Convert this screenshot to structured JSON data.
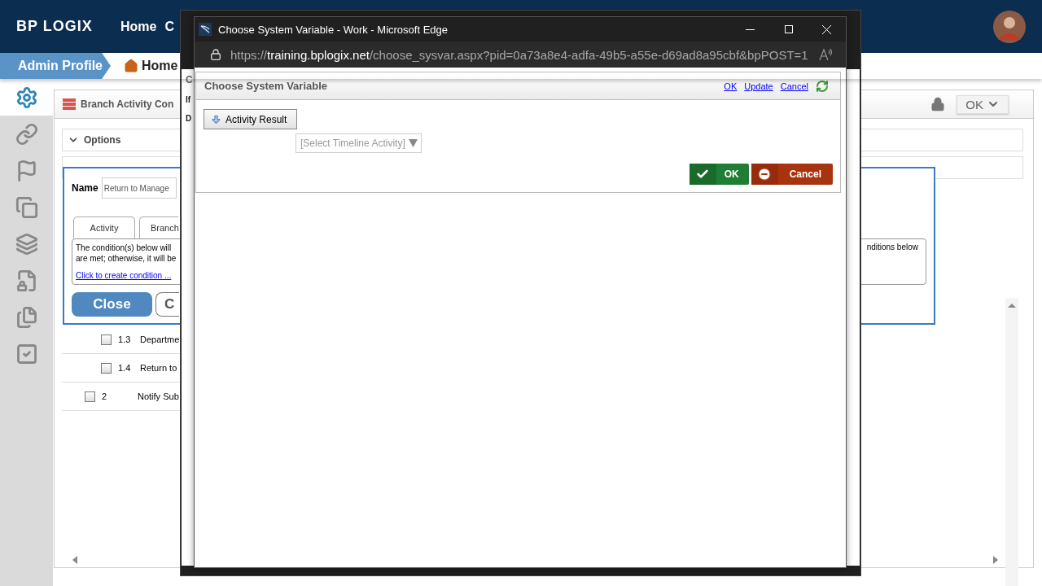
{
  "header": {
    "logo": "BP LOGIX",
    "nav": [
      "Home",
      "C"
    ]
  },
  "breadcrumb": [
    {
      "label": "Admin Profile",
      "kind": "profile"
    },
    {
      "label": "Home",
      "kind": "home"
    }
  ],
  "sidebar": {
    "items": [
      {
        "selected": true
      },
      {
        "selected": false
      },
      {
        "selected": false
      },
      {
        "selected": false
      },
      {
        "selected": false
      },
      {
        "selected": false
      },
      {
        "selected": false
      },
      {
        "selected": false
      }
    ]
  },
  "panel": {
    "title": "Branch Activity Con",
    "action": "OK",
    "section": {
      "label": "Options",
      "expanded": true
    },
    "rows": [
      {
        "kind": "sub",
        "checked": false,
        "number": "1.3",
        "name": "Departme"
      },
      {
        "kind": "sub",
        "checked": false,
        "number": "1.4",
        "name": "Return to"
      },
      {
        "kind": "main",
        "checked": false,
        "number": "2",
        "name": "Notify Sub"
      }
    ]
  },
  "branch_dialog": {
    "name_label": "Name",
    "name_value": "Return to Manage",
    "tabs": [
      "Activity",
      "Branch"
    ],
    "condition_lines": [
      "The condition(s) below will",
      "are met; otherwise, it will be"
    ],
    "condition_tail": "nditions below",
    "condition_link": "Click to create condition ...",
    "buttons": [
      "Close",
      "C"
    ]
  },
  "back_window": {
    "fragments": [
      "C",
      "If",
      "D"
    ]
  },
  "browser": {
    "title": "Choose System Variable - Work - Microsoft Edge",
    "url_scheme": "https://",
    "url_host": "training.bplogix.net",
    "url_path": "/choose_sysvar.aspx?pid=0a73a8e4-adfa-49b5-a55e-d69ad8a95cbf&bpPOST=1"
  },
  "chooser": {
    "title": "Choose System Variable",
    "links": [
      "OK",
      "Update",
      "Cancel"
    ],
    "variable_button": "Activity Result",
    "select_value": "[Select Timeline Activity]",
    "ok": "OK",
    "cancel": "Cancel"
  }
}
